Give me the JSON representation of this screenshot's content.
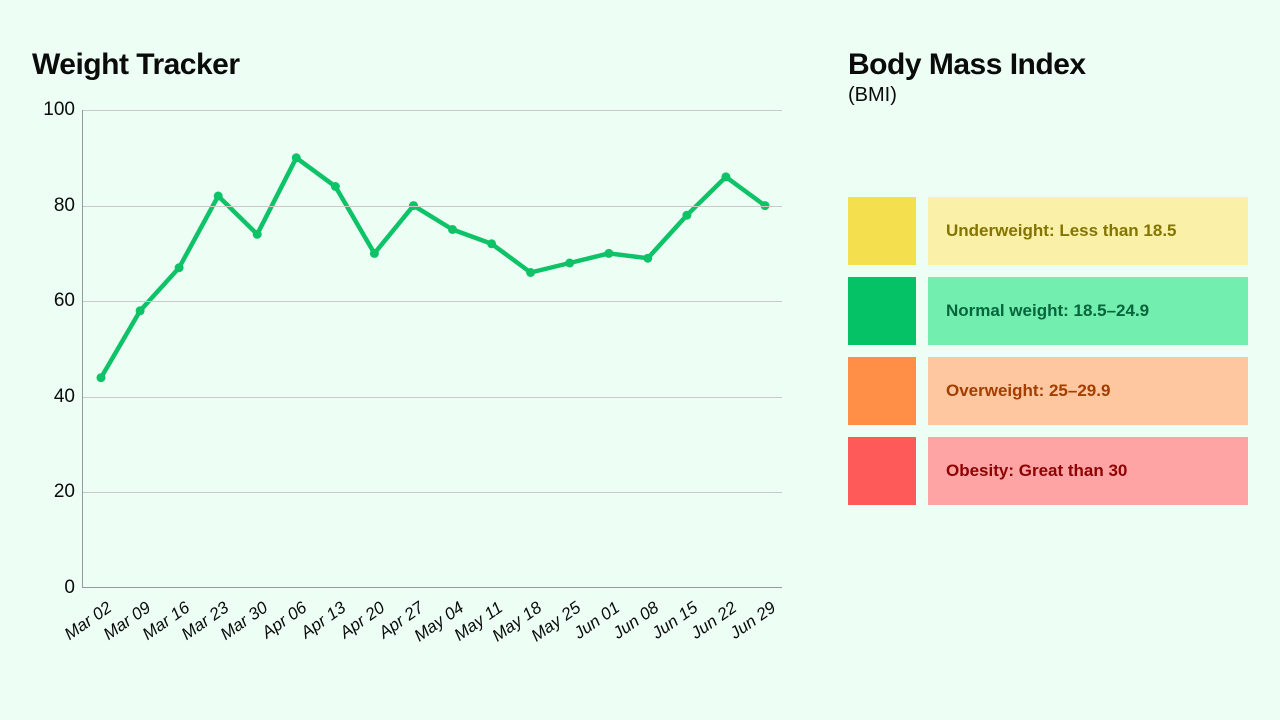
{
  "tracker": {
    "title": "Weight Tracker"
  },
  "bmi": {
    "title": "Body Mass Index",
    "subtitle": "(BMI)",
    "items": [
      {
        "label": "Underweight: Less than 18.5",
        "swatch": "#f4e04e",
        "bg": "#faf0a7",
        "text_color": "#847400"
      },
      {
        "label": "Normal weight: 18.5–24.9",
        "swatch": "#06c266",
        "bg": "#72efae",
        "text_color": "#06653c"
      },
      {
        "label": "Overweight: 25–29.9",
        "swatch": "#ff8e47",
        "bg": "#ffc7a0",
        "text_color": "#a33d00"
      },
      {
        "label": "Obesity: Great than 30",
        "swatch": "#ff5a5a",
        "bg": "#ffa4a4",
        "text_color": "#8f0000"
      }
    ]
  },
  "chart_data": {
    "type": "line",
    "title": "Weight Tracker",
    "xlabel": "",
    "ylabel": "",
    "ylim": [
      0,
      100
    ],
    "yticks": [
      0,
      20,
      40,
      60,
      80,
      100
    ],
    "categories": [
      "Mar 02",
      "Mar 09",
      "Mar 16",
      "Mar 23",
      "Mar 30",
      "Apr 06",
      "Apr 13",
      "Apr 20",
      "Apr 27",
      "May 04",
      "May 11",
      "May 18",
      "May 25",
      "Jun 01",
      "Jun 08",
      "Jun 15",
      "Jun 22",
      "Jun 29"
    ],
    "values": [
      44,
      58,
      67,
      82,
      74,
      90,
      84,
      70,
      80,
      75,
      72,
      66,
      68,
      70,
      69,
      78,
      86,
      80
    ],
    "line_color": "#0ec268"
  }
}
